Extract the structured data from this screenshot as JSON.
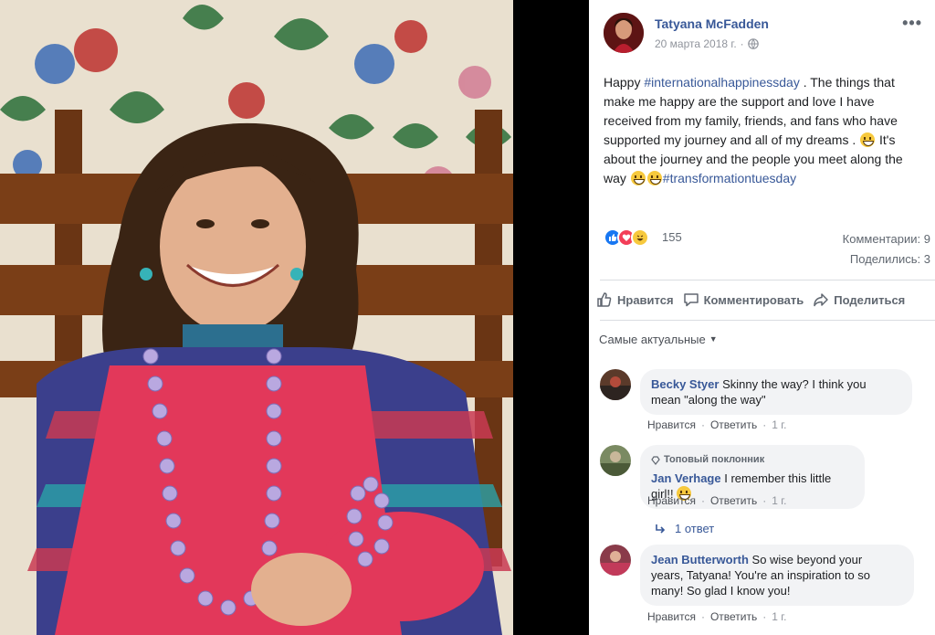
{
  "photo": {
    "description_icon": "photo-child-smiling"
  },
  "post": {
    "author": "Tatyana McFadden",
    "date": "20 марта 2018 г.",
    "audience_icon": "globe-icon",
    "more_icon": "more-icon",
    "text_parts": {
      "p1": "Happy ",
      "h1": "#internationalhappinessday",
      "p2": " . The things that make me happy are the support and love I have received from my family, friends, and fans who have supported my journey and all of my dreams . ",
      "p3": " It's about the journey and the people you meet along the way ",
      "h2": "#transformationtuesday"
    }
  },
  "stats": {
    "reaction_count": "155",
    "comments": "Комментарии: 9",
    "shares": "Поделились: 3"
  },
  "actions": {
    "like": "Нравится",
    "comment": "Комментировать",
    "share": "Поделиться"
  },
  "sort": {
    "label": "Самые актуальные"
  },
  "comments": [
    {
      "name": "Becky Styer",
      "text_line1": " Skinny the way? I think you",
      "text_line2": "mean \"along the way\"",
      "like": "Нравится",
      "reply": "Ответить",
      "time": "1 г."
    },
    {
      "badge": "Топовый поклонник",
      "name": "Jan Verhage",
      "text": " I remember this little girl!! ",
      "like": "Нравится",
      "reply": "Ответить",
      "time": "1 г.",
      "replies": "1 ответ"
    },
    {
      "name": "Jean Butterworth",
      "text_line1": " So wise beyond your",
      "text_line2": "years, Tatyana! You're an inspiration to so",
      "text_line3": "many! So glad I know you!",
      "like": "Нравится",
      "reply": "Ответить",
      "time": "1 г."
    }
  ],
  "colors": {
    "link": "#385898",
    "like_blue": "#1877f2",
    "love_red": "#f33e58",
    "haha_yellow": "#f7c93d"
  }
}
